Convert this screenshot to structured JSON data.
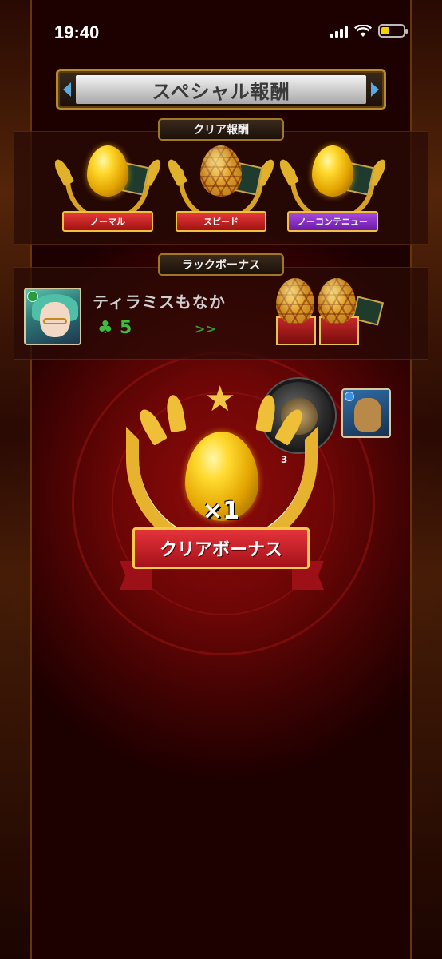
{
  "status_bar": {
    "time": "19:40"
  },
  "header": {
    "title": "スペシャル報酬"
  },
  "clear_rewards": {
    "label": "クリア報酬",
    "items": [
      {
        "label": "ノーマル",
        "egg": "gold-egg",
        "ribbon_color": "#c81e1e"
      },
      {
        "label": "スピード",
        "egg": "hex-egg",
        "ribbon_color": "#c81e1e"
      },
      {
        "label": "ノーコンテニュー",
        "egg": "gold-egg",
        "ribbon_color": "#8a2fcf"
      }
    ]
  },
  "luck_bonus": {
    "label": "ラックボーナス",
    "character_name": "ティラミスもなか",
    "clover": "♣",
    "luck_value": "5",
    "arrow": ">>",
    "reward_icons": [
      "hex-egg",
      "hex-egg"
    ]
  },
  "drops": {
    "orb_count": "3"
  },
  "clear_bonus": {
    "star": "★",
    "multiplier": "×1",
    "label": "クリアボーナス"
  }
}
